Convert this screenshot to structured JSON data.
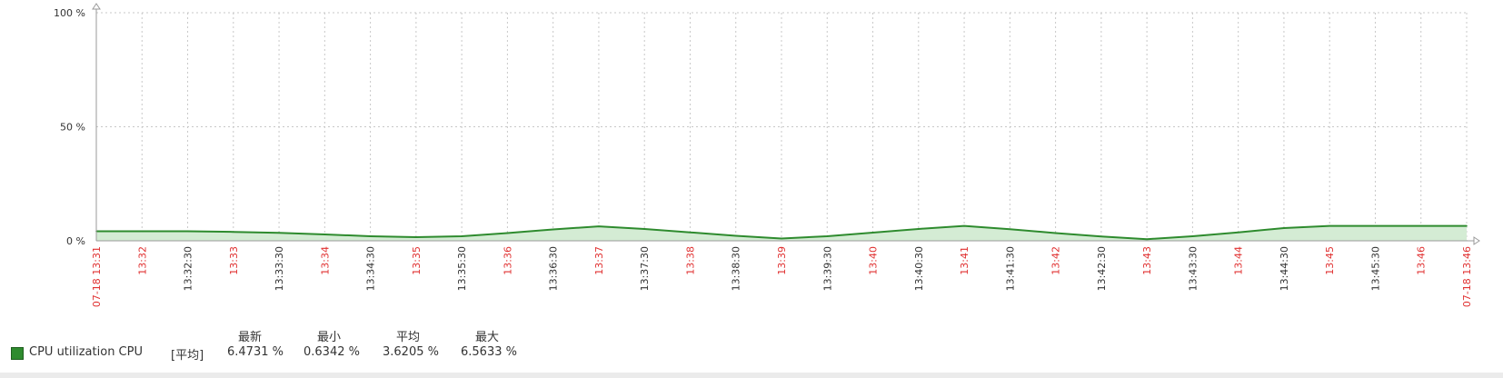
{
  "chart_data": {
    "type": "area",
    "title": "",
    "ylim": [
      0,
      100
    ],
    "y_ticks": [
      "100 %",
      "50 %",
      "0 %"
    ],
    "y_tick_values": [
      100,
      50,
      0
    ],
    "x_tick_labels": [
      {
        "label": "07-18 13:31",
        "color": "#e03030"
      },
      {
        "label": "13:32",
        "color": "#e03030"
      },
      {
        "label": "13:32:30",
        "color": "#333333"
      },
      {
        "label": "13:33",
        "color": "#e03030"
      },
      {
        "label": "13:33:30",
        "color": "#333333"
      },
      {
        "label": "13:34",
        "color": "#e03030"
      },
      {
        "label": "13:34:30",
        "color": "#333333"
      },
      {
        "label": "13:35",
        "color": "#e03030"
      },
      {
        "label": "13:35:30",
        "color": "#333333"
      },
      {
        "label": "13:36",
        "color": "#e03030"
      },
      {
        "label": "13:36:30",
        "color": "#333333"
      },
      {
        "label": "13:37",
        "color": "#e03030"
      },
      {
        "label": "13:37:30",
        "color": "#333333"
      },
      {
        "label": "13:38",
        "color": "#e03030"
      },
      {
        "label": "13:38:30",
        "color": "#333333"
      },
      {
        "label": "13:39",
        "color": "#e03030"
      },
      {
        "label": "13:39:30",
        "color": "#333333"
      },
      {
        "label": "13:40",
        "color": "#e03030"
      },
      {
        "label": "13:40:30",
        "color": "#333333"
      },
      {
        "label": "13:41",
        "color": "#e03030"
      },
      {
        "label": "13:41:30",
        "color": "#333333"
      },
      {
        "label": "13:42",
        "color": "#e03030"
      },
      {
        "label": "13:42:30",
        "color": "#333333"
      },
      {
        "label": "13:43",
        "color": "#e03030"
      },
      {
        "label": "13:43:30",
        "color": "#333333"
      },
      {
        "label": "13:44",
        "color": "#e03030"
      },
      {
        "label": "13:44:30",
        "color": "#333333"
      },
      {
        "label": "13:45",
        "color": "#e03030"
      },
      {
        "label": "13:45:30",
        "color": "#333333"
      },
      {
        "label": "13:46",
        "color": "#e03030"
      },
      {
        "label": "07-18 13:46",
        "color": "#e03030"
      }
    ],
    "series": [
      {
        "name": "CPU utilization CPU",
        "color": "#2e8b2e",
        "fill": "#d4ecd4",
        "x": [
          "13:31:00",
          "13:31:30",
          "13:32:00",
          "13:32:30",
          "13:33:00",
          "13:33:30",
          "13:34:00",
          "13:34:30",
          "13:35:00",
          "13:35:30",
          "13:36:00",
          "13:36:30",
          "13:37:00",
          "13:37:30",
          "13:38:00",
          "13:38:30",
          "13:39:00",
          "13:39:30",
          "13:40:00",
          "13:40:30",
          "13:41:00",
          "13:41:30",
          "13:42:00",
          "13:42:30",
          "13:43:00",
          "13:43:30",
          "13:44:00",
          "13:44:30",
          "13:45:00",
          "13:45:30",
          "13:46:00"
        ],
        "values": [
          4.2,
          4.2,
          4.2,
          3.9,
          3.5,
          2.8,
          2.0,
          1.6,
          2.0,
          3.4,
          5.0,
          6.3,
          5.2,
          3.7,
          2.2,
          1.0,
          2.0,
          3.6,
          5.2,
          6.5,
          5.1,
          3.4,
          1.9,
          0.7,
          2.0,
          3.7,
          5.6,
          6.5,
          6.5,
          6.5,
          6.5
        ]
      }
    ],
    "grid": true
  },
  "legend": {
    "headers": [
      "最新",
      "最小",
      "平均",
      "最大"
    ],
    "row": {
      "name": "CPU utilization CPU",
      "func": "[平均]",
      "latest": "6.4731 %",
      "min": "0.6342 %",
      "avg": "3.6205 %",
      "max": "6.5633 %"
    }
  }
}
